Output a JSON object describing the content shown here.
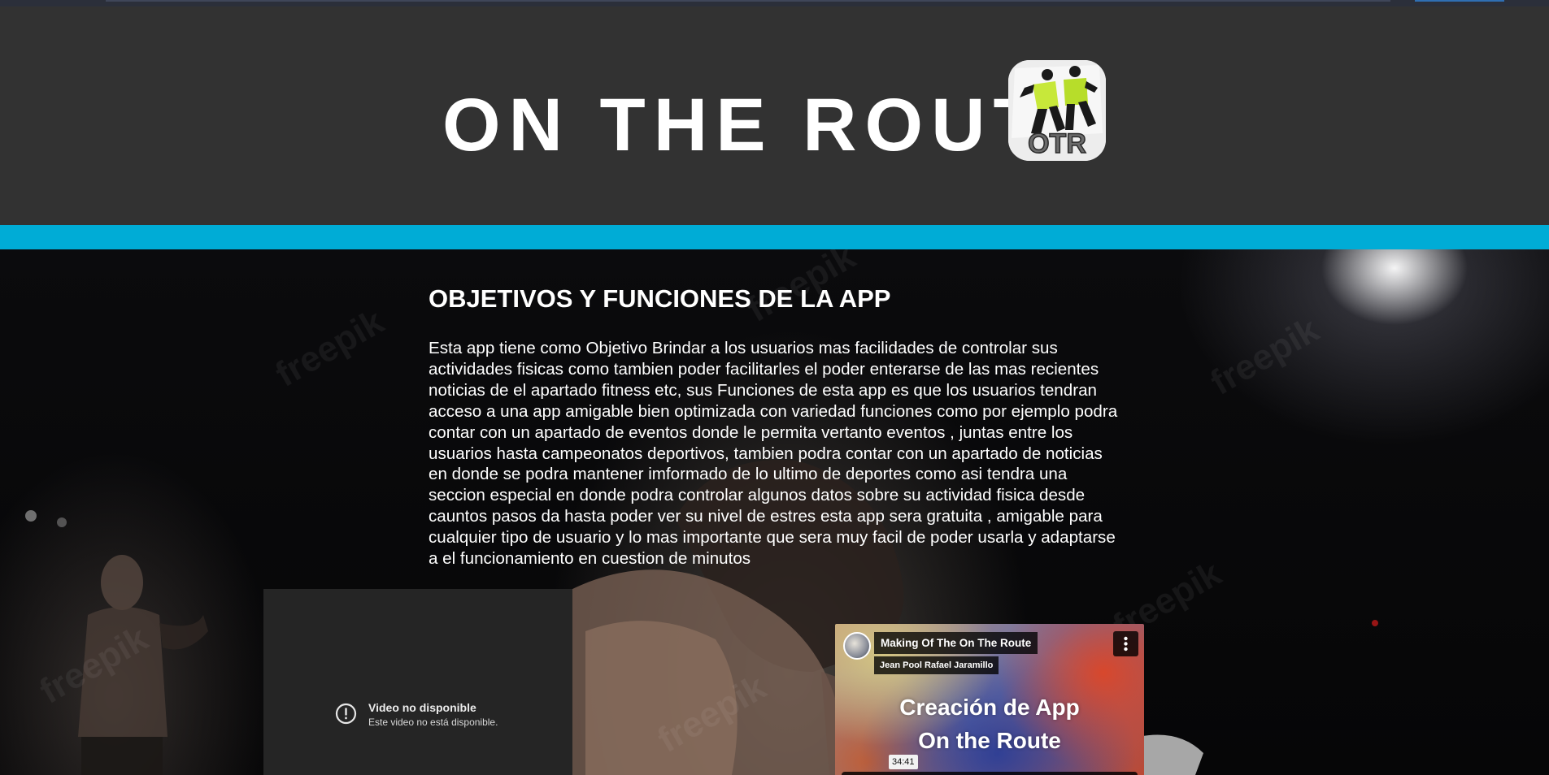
{
  "header": {
    "title": "ON THE ROUT",
    "logo": {
      "icon": "otr-logo",
      "text": "OTR"
    }
  },
  "colors": {
    "header_bg": "#323232",
    "accent_band": "#00acd6",
    "text": "#ffffff"
  },
  "main": {
    "section_title": "OBJETIVOS Y FUNCIONES DE LA APP",
    "section_body": "Esta app tiene como Objetivo Brindar a los usuarios mas facilidades de controlar sus actividades fisicas como tambien poder facilitarles el poder enterarse de las mas recientes noticias de el apartado fitness etc, sus Funciones de esta app es que los usuarios tendran acceso a una app amigable bien optimizada con variedad funciones como por ejemplo podra contar con un apartado de eventos donde le permita vertanto eventos , juntas entre los usuarios hasta campeonatos deportivos, tambien podra contar con un apartado de noticias en donde se podra mantener imformado de lo ultimo de deportes como asi tendra una seccion especial en donde podra controlar algunos datos sobre su actividad fisica desde cauntos pasos da hasta poder ver su nivel de estres esta app sera gratuita , amigable para cualquier tipo de usuario y lo mas importante que sera muy facil de poder usarla y adaptarse a el funcionamiento en cuestion de minutos"
  },
  "video_unavailable": {
    "icon": "alert-circle-icon",
    "title": "Video no disponible",
    "subtitle": "Este video no está disponible."
  },
  "video_embed": {
    "title": "Making Of The On The Route",
    "channel": "Jean Pool Rafael Jaramillo",
    "headline_line1": "Creación de App",
    "headline_line2": "On the Route",
    "duration": "34:41",
    "icons": [
      "channel-avatar",
      "more-vert-icon",
      "play-icon",
      "fullscreen-icon"
    ]
  }
}
